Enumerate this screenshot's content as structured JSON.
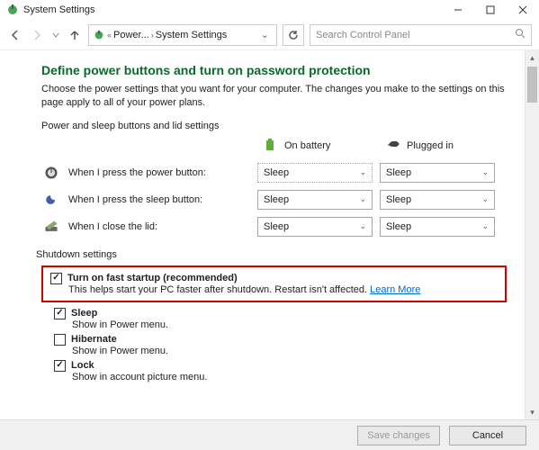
{
  "window": {
    "title": "System Settings"
  },
  "nav": {
    "crumb_parent": "Power...",
    "crumb_self": "System Settings",
    "search_placeholder": "Search Control Panel"
  },
  "page": {
    "title": "Define power buttons and turn on password protection",
    "desc": "Choose the power settings that you want for your computer. The changes you make to the settings on this page apply to all of your power plans.",
    "buttons_section_label": "Power and sleep buttons and lid settings",
    "col_battery": "On battery",
    "col_plugged": "Plugged in",
    "rows": [
      {
        "label": "When I press the power button:",
        "battery": "Sleep",
        "plugged": "Sleep"
      },
      {
        "label": "When I press the sleep button:",
        "battery": "Sleep",
        "plugged": "Sleep"
      },
      {
        "label": "When I close the lid:",
        "battery": "Sleep",
        "plugged": "Sleep"
      }
    ],
    "shutdown_label": "Shutdown settings",
    "fast_startup": {
      "checked": true,
      "title": "Turn on fast startup (recommended)",
      "desc": "This helps start your PC faster after shutdown. Restart isn't affected.",
      "learn_more": "Learn More"
    },
    "sleep": {
      "checked": true,
      "title": "Sleep",
      "desc": "Show in Power menu."
    },
    "hibernate": {
      "checked": false,
      "title": "Hibernate",
      "desc": "Show in Power menu."
    },
    "lock": {
      "checked": true,
      "title": "Lock",
      "desc": "Show in account picture menu."
    }
  },
  "footer": {
    "save": "Save changes",
    "cancel": "Cancel"
  }
}
